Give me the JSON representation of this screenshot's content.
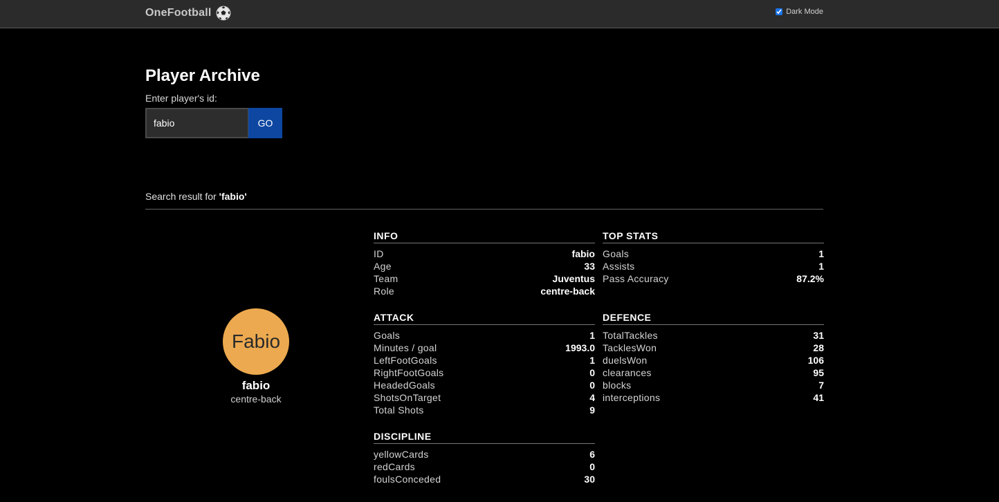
{
  "header": {
    "brand": "OneFootball",
    "brand_icon": "soccer-ball-icon",
    "dark_mode_label": "Dark Mode",
    "dark_mode_checked": true
  },
  "search": {
    "title": "Player Archive",
    "prompt": "Enter player's id:",
    "value": "fabio",
    "button_label": "GO",
    "result_prefix": "Search result for ",
    "result_query": "'fabio'"
  },
  "profile": {
    "avatar_text": "Fabio",
    "avatar_color": "#eca94f",
    "name": "fabio",
    "role": "centre-back"
  },
  "info": {
    "title": "INFO",
    "rows": [
      {
        "label": "ID",
        "value": "fabio"
      },
      {
        "label": "Age",
        "value": "33"
      },
      {
        "label": "Team",
        "value": "Juventus"
      },
      {
        "label": "Role",
        "value": "centre-back"
      }
    ]
  },
  "top_stats": {
    "title": "TOP STATS",
    "rows": [
      {
        "label": "Goals",
        "value": "1"
      },
      {
        "label": "Assists",
        "value": "1"
      },
      {
        "label": "Pass Accuracy",
        "value": "87.2%"
      }
    ]
  },
  "attack": {
    "title": "ATTACK",
    "rows": [
      {
        "label": "Goals",
        "value": "1"
      },
      {
        "label": "Minutes / goal",
        "value": "1993.0"
      },
      {
        "label": "LeftFootGoals",
        "value": "1"
      },
      {
        "label": "RightFootGoals",
        "value": "0"
      },
      {
        "label": "HeadedGoals",
        "value": "0"
      },
      {
        "label": "ShotsOnTarget",
        "value": "4"
      },
      {
        "label": "Total Shots",
        "value": "9"
      }
    ]
  },
  "defence": {
    "title": "DEFENCE",
    "rows": [
      {
        "label": "TotalTackles",
        "value": "31"
      },
      {
        "label": "TacklesWon",
        "value": "28"
      },
      {
        "label": "duelsWon",
        "value": "106"
      },
      {
        "label": "clearances",
        "value": "95"
      },
      {
        "label": "blocks",
        "value": "7"
      },
      {
        "label": "interceptions",
        "value": "41"
      }
    ]
  },
  "discipline": {
    "title": "DISCIPLINE",
    "rows": [
      {
        "label": "yellowCards",
        "value": "6"
      },
      {
        "label": "redCards",
        "value": "0"
      },
      {
        "label": "foulsConceded",
        "value": "30"
      }
    ]
  }
}
